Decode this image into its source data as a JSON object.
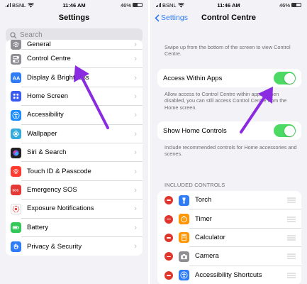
{
  "status": {
    "carrier": "BSNL",
    "time": "11:46 AM",
    "battery": "46%",
    "battery_level": 0.46
  },
  "left": {
    "title": "Settings",
    "search_placeholder": "Search",
    "items": [
      {
        "label": "General",
        "icon": "gear-icon",
        "color": "#8e8e93"
      },
      {
        "label": "Control Centre",
        "icon": "switches-icon",
        "color": "#8e8e93"
      },
      {
        "label": "Display & Brightness",
        "icon": "aa-icon",
        "color": "#2f7cf6"
      },
      {
        "label": "Home Screen",
        "icon": "grid-icon",
        "color": "#3a5cf0"
      },
      {
        "label": "Accessibility",
        "icon": "accessibility-icon",
        "color": "#1a8cff"
      },
      {
        "label": "Wallpaper",
        "icon": "flower-icon",
        "color": "#34aadc"
      },
      {
        "label": "Siri & Search",
        "icon": "siri-icon",
        "color": "#222222"
      },
      {
        "label": "Touch ID & Passcode",
        "icon": "fingerprint-icon",
        "color": "#ff3b30"
      },
      {
        "label": "Emergency SOS",
        "icon": "sos-icon",
        "color": "#e53935"
      },
      {
        "label": "Exposure Notifications",
        "icon": "exposure-icon",
        "color": "#ffffff"
      },
      {
        "label": "Battery",
        "icon": "battery-icon",
        "color": "#34c759"
      },
      {
        "label": "Privacy & Security",
        "icon": "hand-icon",
        "color": "#2f7cf6"
      }
    ]
  },
  "right": {
    "back_label": "Settings",
    "title": "Control Centre",
    "intro": "Swipe up from the bottom of the screen to view Control Centre.",
    "access_label": "Access Within Apps",
    "access_on": true,
    "access_desc": "Allow access to Control Centre within apps. When disabled, you can still access Control Centre from the Home screen.",
    "home_label": "Show Home Controls",
    "home_on": true,
    "home_desc": "Include recommended controls for Home accessories and scenes.",
    "section": "INCLUDED CONTROLS",
    "controls": [
      {
        "label": "Torch",
        "icon": "torch-icon",
        "color": "#2f7cf6"
      },
      {
        "label": "Timer",
        "icon": "timer-icon",
        "color": "#ff9500"
      },
      {
        "label": "Calculator",
        "icon": "calculator-icon",
        "color": "#ff9500"
      },
      {
        "label": "Camera",
        "icon": "camera-icon",
        "color": "#8e8e93"
      },
      {
        "label": "Accessibility Shortcuts",
        "icon": "accessibility-icon",
        "color": "#2f7cf6"
      }
    ]
  },
  "colors": {
    "accent": "#2f7cf6",
    "toggle_on": "#4cd964",
    "arrow": "#8a2be2",
    "delete": "#e0352b"
  }
}
